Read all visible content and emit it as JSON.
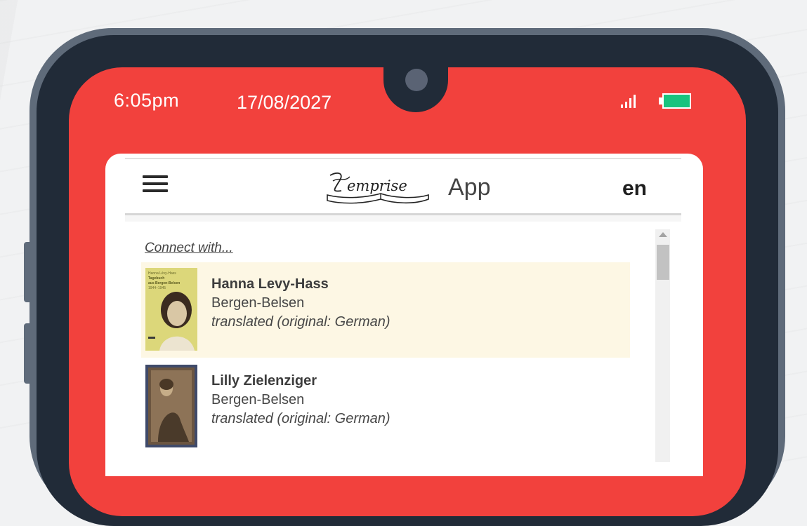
{
  "status_bar": {
    "time": "6:05pm",
    "date": "17/08/2027",
    "signal_icon": "signal-bars-icon",
    "battery_icon": "battery-icon"
  },
  "header": {
    "menu_icon": "hamburger-menu-icon",
    "logo_text": "Memprise",
    "app_label": "App",
    "language": "en"
  },
  "content": {
    "connect_label": "Connect with...",
    "people": [
      {
        "name": "Hanna Levy-Hass",
        "place": "Bergen-Belsen",
        "note": "translated (original: German)",
        "thumb_title": "Tagebuch aus Bergen-Belsen",
        "thumb_author": "Hanna Lévy-Hass",
        "thumb_years": "1944–1945",
        "highlighted": true
      },
      {
        "name": "Lilly Zielenziger",
        "place": "Bergen-Belsen",
        "note": "translated (original: German)",
        "highlighted": false
      }
    ]
  },
  "colors": {
    "screen": "#f2413d",
    "bezel": "#212b38",
    "frame": "#5f6b7a",
    "battery": "#18c37e",
    "highlight_row": "#fdf7e4"
  }
}
